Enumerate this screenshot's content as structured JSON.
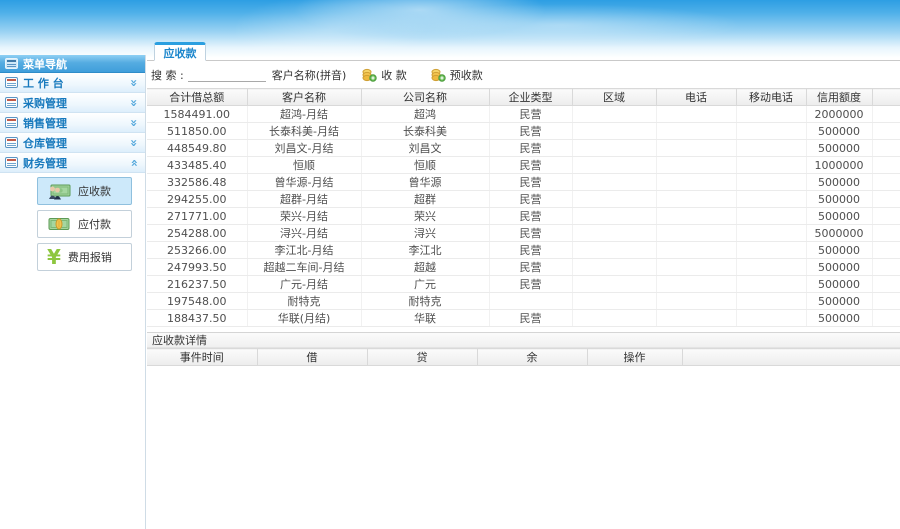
{
  "colors": {
    "accent_blue": "#2b9fe0",
    "nav_text": "#1779bd",
    "selected_bg": "#cde9fa",
    "coin_gold": "#f2c34e",
    "money_green": "#8dc63f"
  },
  "sidebar": {
    "header": {
      "label": "菜单导航"
    },
    "items": [
      {
        "label": "工 作 台",
        "state": "collapsed"
      },
      {
        "label": "采购管理",
        "state": "collapsed"
      },
      {
        "label": "销售管理",
        "state": "collapsed"
      },
      {
        "label": "仓库管理",
        "state": "collapsed"
      },
      {
        "label": "财务管理",
        "state": "expanded"
      }
    ],
    "submenu": [
      {
        "label": "应收款",
        "icon": "receivable-icon",
        "selected": true
      },
      {
        "label": "应付款",
        "icon": "payable-icon",
        "selected": false
      },
      {
        "label": "费用报销",
        "icon": "yen-icon",
        "selected": false
      }
    ]
  },
  "main": {
    "tab": {
      "label": "应收款"
    },
    "toolbar": {
      "search_label": "搜 索 :",
      "search_value": "",
      "field_hint": "客户名称(拼音)",
      "collect_label": "收 款",
      "precollect_label": "预收款"
    },
    "table": {
      "columns": [
        "合计借总额",
        "客户名称",
        "公司名称",
        "企业类型",
        "区域",
        "电话",
        "移动电话",
        "信用额度"
      ],
      "rows": [
        [
          "1584491.00",
          "超鸿-月结",
          "超鸿",
          "民营",
          "",
          "",
          "",
          "2000000"
        ],
        [
          "511850.00",
          "长泰科美-月结",
          "长泰科美",
          "民营",
          "",
          "",
          "",
          "500000"
        ],
        [
          "448549.80",
          "刘昌文-月结",
          "刘昌文",
          "民营",
          "",
          "",
          "",
          "500000"
        ],
        [
          "433485.40",
          "恒顺",
          "恒顺",
          "民营",
          "",
          "",
          "",
          "1000000"
        ],
        [
          "332586.48",
          "曾华源-月结",
          "曾华源",
          "民营",
          "",
          "",
          "",
          "500000"
        ],
        [
          "294255.00",
          "超群-月结",
          "超群",
          "民营",
          "",
          "",
          "",
          "500000"
        ],
        [
          "271771.00",
          "荣兴-月结",
          "荣兴",
          "民营",
          "",
          "",
          "",
          "500000"
        ],
        [
          "254288.00",
          "浔兴-月结",
          "浔兴",
          "民营",
          "",
          "",
          "",
          "5000000"
        ],
        [
          "253266.00",
          "李江北-月结",
          "李江北",
          "民营",
          "",
          "",
          "",
          "500000"
        ],
        [
          "247993.50",
          "超越二车间-月结",
          "超越",
          "民营",
          "",
          "",
          "",
          "500000"
        ],
        [
          "216237.50",
          "广元-月结",
          "广元",
          "民营",
          "",
          "",
          "",
          "500000"
        ],
        [
          "197548.00",
          "耐特克",
          "耐特克",
          "",
          "",
          "",
          "",
          "500000"
        ],
        [
          "188437.50",
          "华联(月结)",
          "华联",
          "民营",
          "",
          "",
          "",
          "500000"
        ]
      ],
      "partial_row": [
        "......",
        "......",
        "......",
        "",
        "",
        "",
        "",
        "......"
      ]
    },
    "detail": {
      "title": "应收款详情",
      "columns": [
        "事件时间",
        "借",
        "贷",
        "余",
        "操作"
      ],
      "rows": []
    }
  }
}
